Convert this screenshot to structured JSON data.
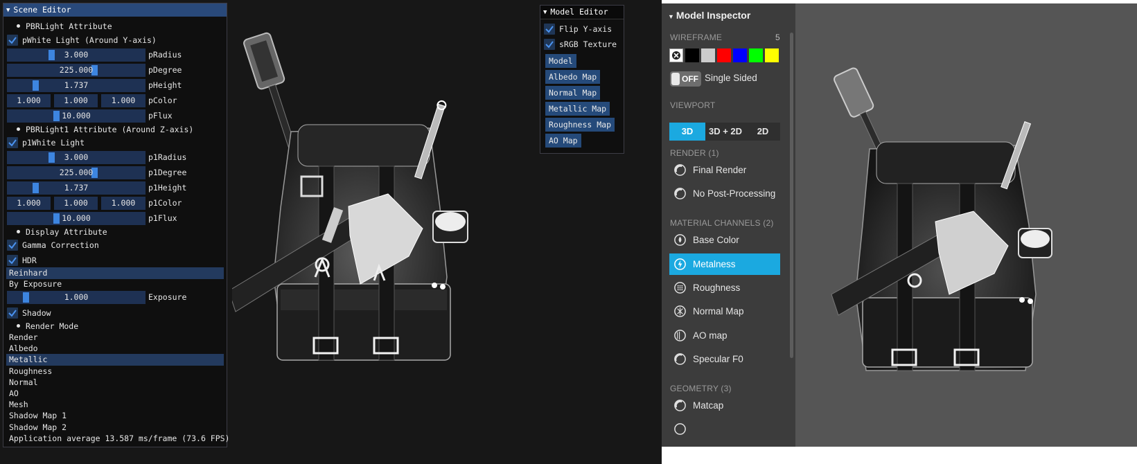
{
  "scene_editor": {
    "title": "Scene Editor",
    "pbr_attr": "PBRLight Attribute",
    "pwhite_label": "pWhite Light (Around Y-axis)",
    "pradius_val": "3.000",
    "pradius_label": "pRadius",
    "pdegree_val": "225.000",
    "pdegree_label": "pDegree",
    "pheight_val": "1.737",
    "pheight_label": "pHeight",
    "pcolor_r": "1.000",
    "pcolor_g": "1.000",
    "pcolor_b": "1.000",
    "pcolor_label": "pColor",
    "pflux_val": "10.000",
    "pflux_label": "pFlux",
    "pbr1_attr": "PBRLight1 Attribute (Around Z-axis)",
    "p1white_label": "p1White Light",
    "p1radius_val": "3.000",
    "p1radius_label": "p1Radius",
    "p1degree_val": "225.000",
    "p1degree_label": "p1Degree",
    "p1height_val": "1.737",
    "p1height_label": "p1Height",
    "p1color_r": "1.000",
    "p1color_g": "1.000",
    "p1color_b": "1.000",
    "p1color_label": "p1Color",
    "p1flux_val": "10.000",
    "p1flux_label": "p1Flux",
    "display_attr": "Display Attribute",
    "gamma_label": "Gamma Correction",
    "hdr_label": "HDR",
    "tonemap_options": [
      "Reinhard",
      "By Exposure"
    ],
    "tonemap_selected": "Reinhard",
    "exposure_val": "1.000",
    "exposure_label": "Exposure",
    "shadow_label": "Shadow",
    "render_mode": "Render Mode",
    "render_modes": [
      "Render",
      "Albedo",
      "Metallic",
      "Roughness",
      "Normal",
      "AO",
      "Mesh",
      "Shadow Map 1",
      "Shadow Map 2"
    ],
    "render_mode_selected": "Metallic",
    "fps_text": "Application average 13.587 ms/frame (73.6 FPS)"
  },
  "model_editor": {
    "title": "Model Editor",
    "flip_label": "Flip Y-axis",
    "srgb_label": "sRGB Texture",
    "buttons": [
      "Model",
      "Albedo Map",
      "Normal Map",
      "Metallic Map",
      "Roughness Map",
      "AO Map"
    ]
  },
  "inspector": {
    "title": "Model Inspector",
    "wireframe_label": "WIREFRAME",
    "wireframe_value": "5",
    "swatch_colors": [
      "#ffffff",
      "#000000",
      "#cccccc",
      "#ff0000",
      "#0000ff",
      "#00ff00",
      "#ffff00"
    ],
    "toggle_state": "OFF",
    "single_sided_label": "Single Sided",
    "viewport_label": "VIEWPORT",
    "viewport_options": [
      "3D",
      "3D + 2D",
      "2D"
    ],
    "viewport_selected": "3D",
    "render_section": "RENDER (1)",
    "render_items": [
      "Final Render",
      "No Post-Processing"
    ],
    "material_section": "MATERIAL CHANNELS (2)",
    "material_items": [
      "Base Color",
      "Metalness",
      "Roughness",
      "Normal Map",
      "AO map",
      "Specular F0"
    ],
    "material_selected": "Metalness",
    "geometry_section": "GEOMETRY (3)",
    "geometry_items": [
      "Matcap"
    ],
    "accent_color": "#1ba9e0"
  }
}
